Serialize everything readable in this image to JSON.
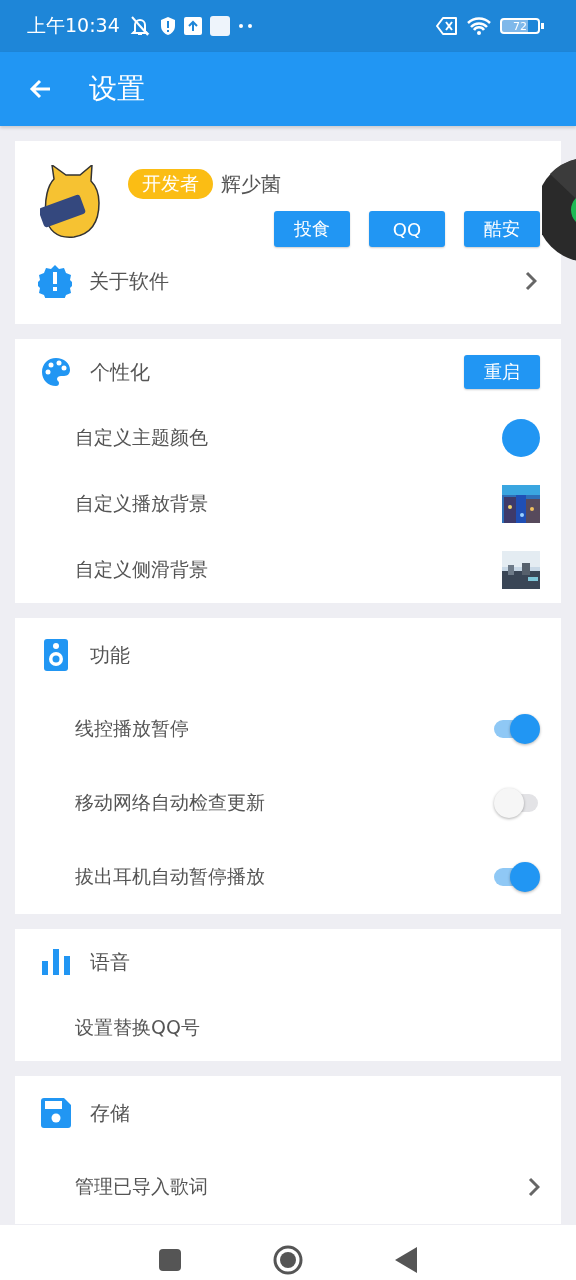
{
  "status_bar": {
    "time": "上午10:34",
    "battery": "72"
  },
  "app_bar": {
    "title": "设置"
  },
  "profile": {
    "badge": "开发者",
    "name": "辉少菌",
    "buttons": [
      "投食",
      "QQ",
      "酷安"
    ],
    "about": "关于软件"
  },
  "sections": [
    {
      "title": "个性化",
      "action": "重启",
      "items": [
        {
          "kind": "color",
          "label": "自定义主题颜色",
          "color": "#2196f3"
        },
        {
          "label": "自定义播放背景"
        },
        {
          "label": "自定义侧滑背景"
        }
      ]
    },
    {
      "title": "功能",
      "items": [
        {
          "kind": "switch",
          "label": "线控播放暂停",
          "on": true
        },
        {
          "kind": "switch",
          "label": "移动网络自动检查更新",
          "on": false
        },
        {
          "kind": "switch",
          "label": "拔出耳机自动暂停播放",
          "on": true
        }
      ]
    },
    {
      "title": "语音",
      "items": [
        {
          "kind": "plain",
          "label": "设置替换QQ号"
        }
      ]
    },
    {
      "title": "存储",
      "items": [
        {
          "kind": "link",
          "label": "管理已导入歌词"
        }
      ]
    }
  ]
}
